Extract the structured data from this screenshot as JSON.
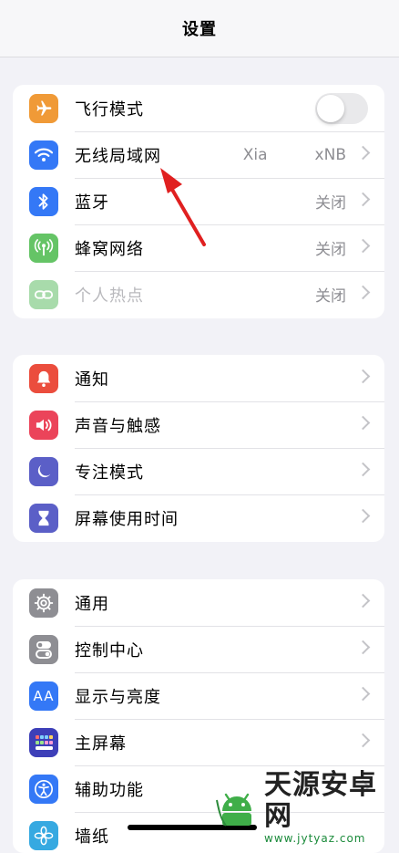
{
  "nav": {
    "title": "设置"
  },
  "colors": {
    "background": "#f2f2f7",
    "orange": "#f09a37",
    "blue": "#3478f6",
    "green": "#65c466",
    "light_green": "#a8dbab",
    "red": "#eb4d3d",
    "pink": "#eb445a",
    "indigo": "#5b5fc7",
    "gray": "#8e8e93",
    "arrow": "#e02020"
  },
  "group1": {
    "items": [
      {
        "label": "飞行模式",
        "icon": "airplane-icon",
        "toggle": "off"
      },
      {
        "label": "无线局域网",
        "icon": "wifi-icon",
        "value_left": "Xia",
        "value_right": "xNB"
      },
      {
        "label": "蓝牙",
        "icon": "bluetooth-icon",
        "value": "关闭"
      },
      {
        "label": "蜂窝网络",
        "icon": "antenna-icon",
        "value": "关闭"
      },
      {
        "label": "个人热点",
        "icon": "hotspot-link-icon",
        "value": "关闭"
      }
    ]
  },
  "group2": {
    "items": [
      {
        "label": "通知",
        "icon": "bell-icon"
      },
      {
        "label": "声音与触感",
        "icon": "speaker-icon"
      },
      {
        "label": "专注模式",
        "icon": "moon-icon"
      },
      {
        "label": "屏幕使用时间",
        "icon": "hourglass-icon"
      }
    ]
  },
  "group3": {
    "items": [
      {
        "label": "通用",
        "icon": "gear-icon"
      },
      {
        "label": "控制中心",
        "icon": "toggles-icon"
      },
      {
        "label": "显示与亮度",
        "icon": "text-size-icon",
        "icon_text": "AA"
      },
      {
        "label": "主屏幕",
        "icon": "app-grid-icon"
      },
      {
        "label": "辅助功能",
        "icon": "accessibility-icon"
      },
      {
        "label": "墙纸",
        "icon": "flower-icon"
      }
    ]
  },
  "watermark": {
    "title": "天源安卓网",
    "url": "www.jytyaz.com"
  }
}
